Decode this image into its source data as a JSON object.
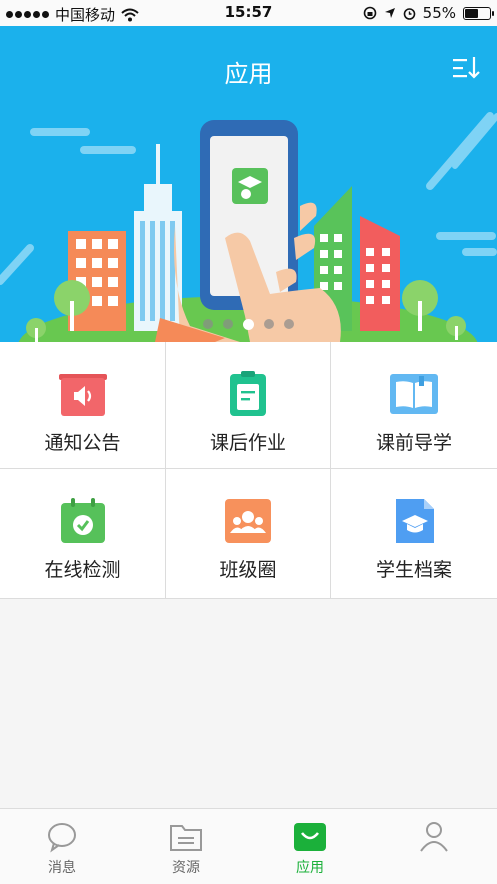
{
  "status": {
    "carrier": "中国移动",
    "time": "15:57",
    "battery": "55%"
  },
  "header": {
    "title": "应用"
  },
  "carousel": {
    "active_index": 2,
    "count": 5
  },
  "apps": [
    {
      "label": "通知公告",
      "icon": "megaphone-icon",
      "color": "#f2666a"
    },
    {
      "label": "课后作业",
      "icon": "clipboard-icon",
      "color": "#20c28f"
    },
    {
      "label": "课前导学",
      "icon": "book-icon",
      "color": "#62b8f2"
    },
    {
      "label": "在线检测",
      "icon": "calendar-check-icon",
      "color": "#56c15a"
    },
    {
      "label": "班级圈",
      "icon": "group-icon",
      "color": "#f7915c"
    },
    {
      "label": "学生档案",
      "icon": "graduation-file-icon",
      "color": "#4f9ef2"
    }
  ],
  "tabbar": {
    "items": [
      {
        "label": "消息",
        "icon": "chat-icon"
      },
      {
        "label": "资源",
        "icon": "folder-icon"
      },
      {
        "label": "应用",
        "icon": "apps-icon"
      },
      {
        "label": "",
        "icon": "person-icon"
      }
    ],
    "active_index": 2
  },
  "colors": {
    "header_bg": "#1bb1ec",
    "active_tab": "#1bb03a"
  }
}
